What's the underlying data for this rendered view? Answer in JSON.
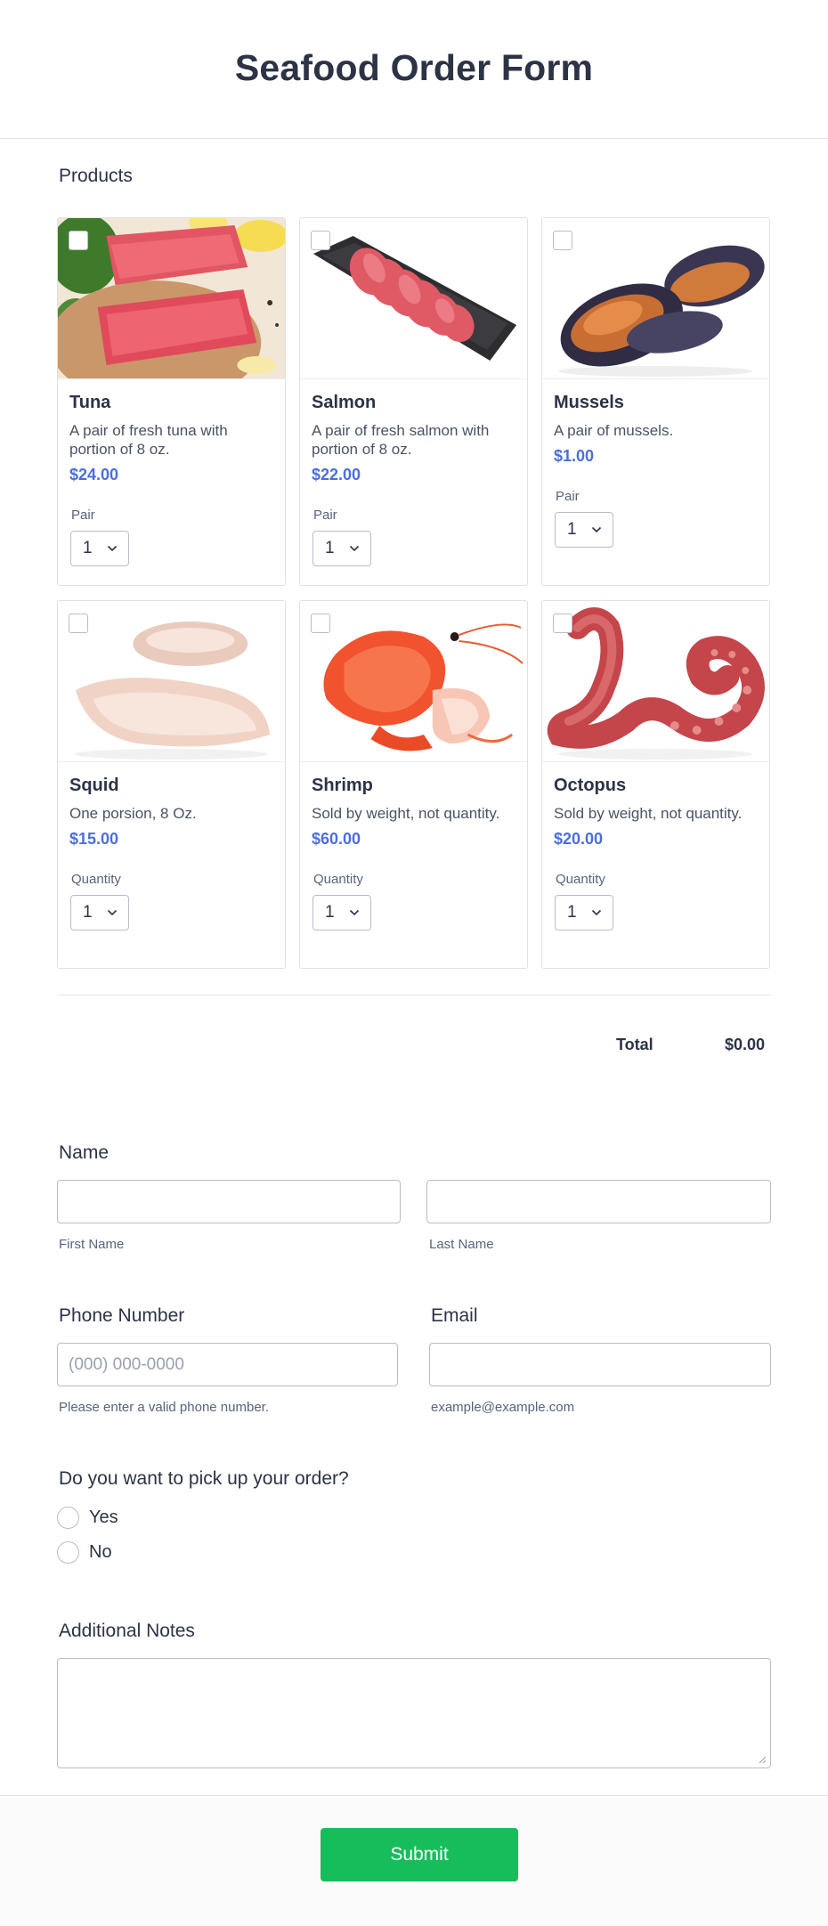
{
  "form": {
    "title": "Seafood Order Form"
  },
  "products": {
    "label": "Products",
    "items": [
      {
        "name": "Tuna",
        "description": "A pair of fresh tuna with portion of 8 oz.",
        "price": "$24.00",
        "option_label": "Pair",
        "quantity": "1",
        "image": "tuna-image"
      },
      {
        "name": "Salmon",
        "description": "A pair of fresh salmon with portion of 8 oz.",
        "price": "$22.00",
        "option_label": "Pair",
        "quantity": "1",
        "image": "salmon-image"
      },
      {
        "name": "Mussels",
        "description": "A pair of mussels.",
        "price": "$1.00",
        "option_label": "Pair",
        "quantity": "1",
        "image": "mussels-image"
      },
      {
        "name": "Squid",
        "description": "One porsion, 8 Oz.",
        "price": "$15.00",
        "option_label": "Quantity",
        "quantity": "1",
        "image": "squid-image"
      },
      {
        "name": "Shrimp",
        "description": "Sold by weight, not quantity.",
        "price": "$60.00",
        "option_label": "Quantity",
        "quantity": "1",
        "image": "shrimp-image"
      },
      {
        "name": "Octopus",
        "description": "Sold by weight, not quantity.",
        "price": "$20.00",
        "option_label": "Quantity",
        "quantity": "1",
        "image": "octopus-image"
      }
    ],
    "total_label": "Total",
    "total_value": "$0.00"
  },
  "name": {
    "label": "Name",
    "first_sub": "First Name",
    "last_sub": "Last Name",
    "first_value": "",
    "last_value": ""
  },
  "phone": {
    "label": "Phone Number",
    "placeholder": "(000) 000-0000",
    "sub": "Please enter a valid phone number."
  },
  "email": {
    "label": "Email",
    "sub": "example@example.com",
    "value": ""
  },
  "pickup": {
    "question": "Do you want to pick up your order?",
    "options": [
      "Yes",
      "No"
    ]
  },
  "notes": {
    "label": "Additional Notes",
    "value": ""
  },
  "submit": {
    "label": "Submit"
  },
  "colors": {
    "accent_price": "#4a6ee0",
    "submit_bg": "#18bd5b",
    "border": "#b8bdc9"
  }
}
